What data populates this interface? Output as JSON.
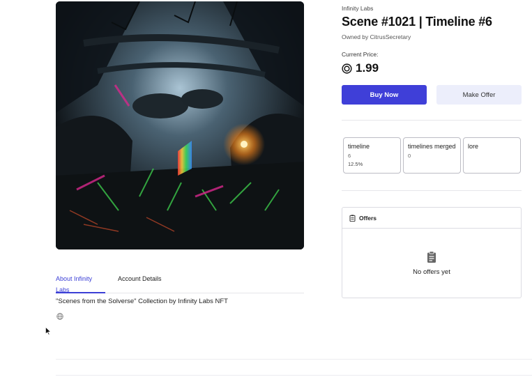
{
  "nft": {
    "collection": "Infinity Labs",
    "title": "Scene #1021 | Timeline #6",
    "owner": "Owned by CitrusSecretary",
    "price_label": "Current Price:",
    "price_value": "1.99",
    "currency_icon": "currency-coin-icon"
  },
  "actions": {
    "buy_label": "Buy Now",
    "offer_label": "Make Offer"
  },
  "traits": [
    {
      "type": "timeline",
      "value": "6",
      "percent": "12.5%"
    },
    {
      "type": "timelines merged",
      "value": "0",
      "percent": ""
    },
    {
      "type": "lore",
      "value": "",
      "percent": ""
    }
  ],
  "offers": {
    "title": "Offers",
    "empty_text": "No offers yet"
  },
  "tabs": [
    {
      "label": "About Infinity Labs",
      "active": true
    },
    {
      "label": "Account Details",
      "active": false
    }
  ],
  "about": {
    "description": "\"Scenes from the Solverse\" Collection by Infinity Labs NFT"
  },
  "colors": {
    "accent": "#3f3fd8",
    "secondary_button": "#eceefb",
    "border": "#dcdce2"
  }
}
